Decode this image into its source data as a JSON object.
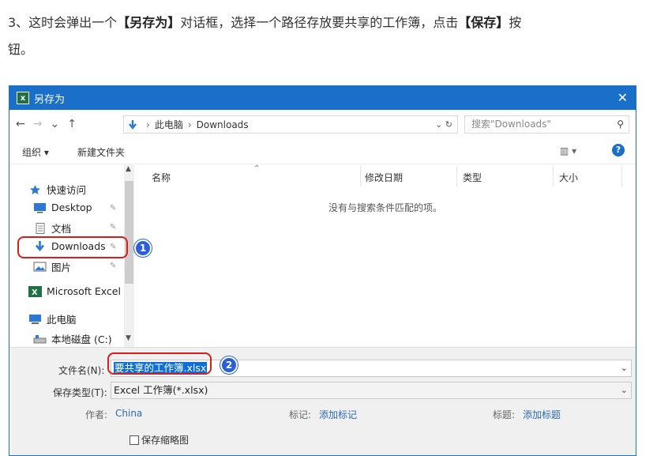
{
  "instruction": {
    "part1": "3、这时会弹出一个",
    "bracket1": "【另存为】",
    "part2": "对话框，选择一个路径存放要共享的工作簿，点击",
    "bracket2": "【保存】",
    "part3": "按",
    "part4": "钮。"
  },
  "dialog": {
    "title": "另存为",
    "close_glyph": "✕",
    "app_icon_letter": "x"
  },
  "address": {
    "back": "←",
    "forward": "→",
    "recent": "⌄",
    "up": "↑",
    "crumbs": [
      "此电脑",
      "Downloads"
    ],
    "separator": "›",
    "refresh": "⌄ ↻",
    "search_placeholder": "搜索\"Downloads\"",
    "search_icon": "⚲"
  },
  "toolbar": {
    "organize_label": "组织 ▾",
    "new_folder_label": "新建文件夹",
    "view_label": "▥ ▾",
    "help_label": "?"
  },
  "nav_pane": {
    "items": [
      {
        "label": "快速访问",
        "icon": "star-icon"
      },
      {
        "label": "Desktop",
        "icon": "desktop-icon"
      },
      {
        "label": "文档",
        "icon": "document-icon"
      },
      {
        "label": "Downloads",
        "icon": "download-arrow-icon"
      },
      {
        "label": "图片",
        "icon": "pictures-icon"
      },
      {
        "label": "Microsoft Excel",
        "icon": "excel-icon"
      },
      {
        "label": "此电脑",
        "icon": "computer-icon"
      },
      {
        "label": "本地磁盘 (C:)",
        "icon": "drive-icon"
      }
    ],
    "pin_glyph": "✎"
  },
  "columns": [
    "名称",
    "修改日期",
    "类型",
    "大小"
  ],
  "empty_message": "没有与搜索条件匹配的项。",
  "form": {
    "filename_label": "文件名(N):",
    "filename_value": "要共享的工作簿.xlsx",
    "filetype_label": "保存类型(T):",
    "filetype_value": "Excel 工作簿(*.xlsx)",
    "author_label": "作者:",
    "author_value": "China",
    "tags_label": "标记:",
    "tags_value": "添加标记",
    "title_label": "标题:",
    "title_value": "添加标题",
    "thumbnail_label": "保存缩略图"
  },
  "annotations": {
    "badge1": "1",
    "badge2": "2",
    "highlight_color": "#d91d1d",
    "badge_color": "#2b5fd9"
  },
  "colors": {
    "titlebar": "#1a6fc9",
    "selection": "#0f6fd6",
    "link": "#2a6ab3"
  }
}
